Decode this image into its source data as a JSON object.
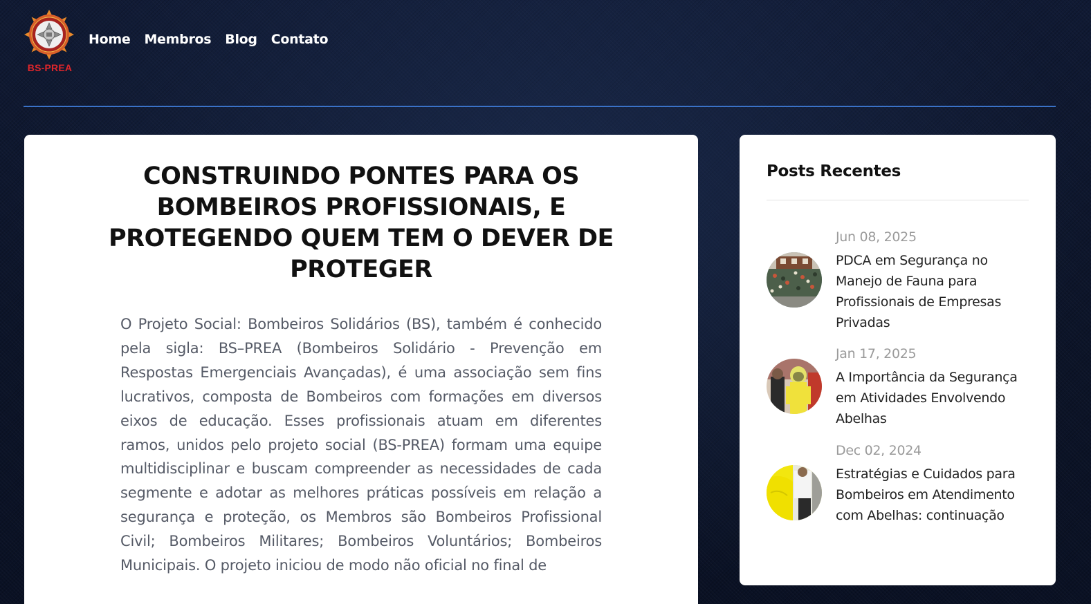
{
  "brand": {
    "logo_text": "BS-PREA",
    "colors": {
      "primary_red": "#e0262b",
      "accent_blue": "#3a72c8",
      "background": "#0f1830"
    }
  },
  "nav": {
    "items": [
      {
        "label": "Home"
      },
      {
        "label": "Membros"
      },
      {
        "label": "Blog"
      },
      {
        "label": "Contato"
      }
    ]
  },
  "article": {
    "title": "CONSTRUINDO PONTES PARA OS BOMBEIROS PROFISSIONAIS, E PROTEGENDO QUEM TEM O DEVER DE PROTEGER",
    "body": "O Projeto Social: Bombeiros Solidários (BS), também é conhecido pela sigla: BS–PREA (Bombeiros Solidário - Prevenção em Respostas Emergenciais Avançadas), é uma associação sem fins lucrativos, composta de Bombeiros com formações em diversos eixos de educação. Esses profissionais atuam em diferentes ramos, unidos pelo projeto social (BS-PREA) formam uma equipe multidisciplinar e buscam compreender as necessidades de cada segmente e adotar as melhores práticas possíveis em relação a segurança e proteção, os Membros são Bombeiros Profissional Civil; Bombeiros Militares; Bombeiros Voluntários; Bombeiros Municipais. O projeto iniciou de modo não oficial no final de"
  },
  "sidebar": {
    "title": "Posts Recentes",
    "posts": [
      {
        "date": "Jun 08, 2025",
        "title": "PDCA em Segurança no Manejo de Fauna para Profissionais de Empresas Privadas",
        "thumb_icon": "gallery-photo-thumbnail"
      },
      {
        "date": "Jan 17, 2025",
        "title": "A Importância da Segurança em Atividades Envolvendo Abelhas",
        "thumb_icon": "beekeeper-suit-photo-thumbnail"
      },
      {
        "date": "Dec 02, 2024",
        "title": "Estratégias e Cuidados para Bombeiros em Atendimento com Abelhas: continuação",
        "thumb_icon": "yellow-suit-photo-thumbnail"
      }
    ]
  }
}
